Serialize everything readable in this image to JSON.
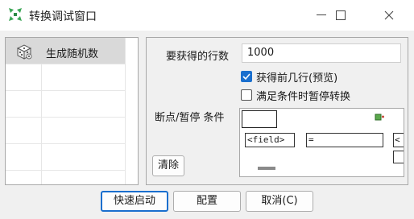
{
  "window": {
    "title": "转换调试窗口",
    "minimize": "—",
    "maximize": "☐",
    "close": "✕"
  },
  "steps": [
    {
      "label": "生成随机数",
      "icon": "dice-icon",
      "selected": true
    }
  ],
  "form": {
    "rows_label": "要获得的行数",
    "rows_value": "1000",
    "first_rows_label": "获得前几行(预览)",
    "first_rows_checked": true,
    "pause_label": "满足条件时暂停转换",
    "pause_checked": false,
    "breakpoint_label": "断点/暂停 条件"
  },
  "condition": {
    "field_placeholder": "<field>",
    "operator": "=",
    "clipped_value": "<"
  },
  "buttons": {
    "clear": "清除",
    "quick_launch": "快速启动",
    "config": "配置",
    "cancel": "取消(C)"
  },
  "colors": {
    "accent": "#1a6fce",
    "app_icon_green": "#3aa655"
  }
}
